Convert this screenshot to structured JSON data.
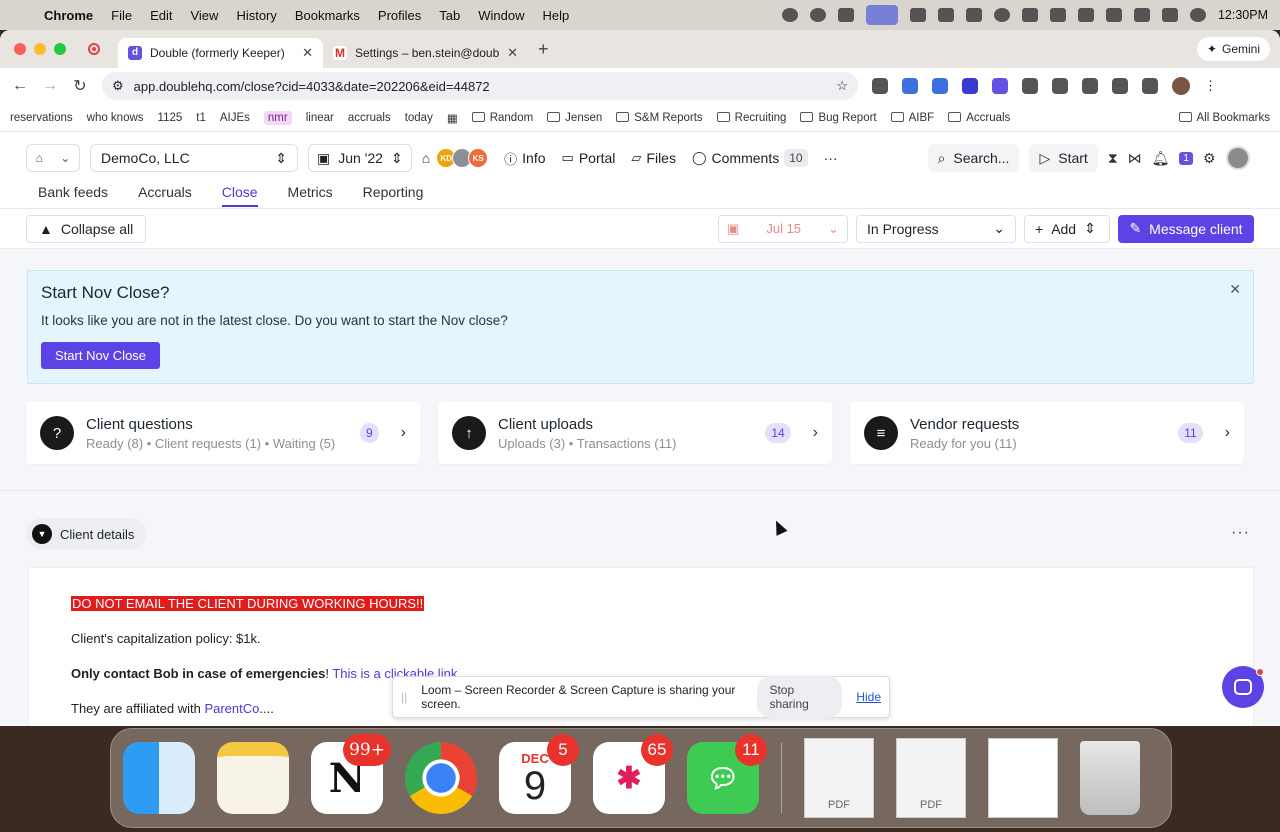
{
  "menubar": {
    "apple": "",
    "items": [
      "Chrome",
      "File",
      "Edit",
      "View",
      "History",
      "Bookmarks",
      "Profiles",
      "Tab",
      "Window",
      "Help"
    ],
    "clock": "12:30PM"
  },
  "browser": {
    "tabs": [
      {
        "title": "Double (formerly Keeper)",
        "favicon": "d"
      },
      {
        "title": "Settings – ben.stein@doublehq",
        "favicon": "M"
      }
    ],
    "gemini": "Gemini",
    "url": "app.doublehq.com/close?cid=4033&date=202206&eid=44872",
    "bookmarks": [
      "reservations",
      "who knows",
      "1125",
      "t1",
      "AIJEs",
      "nmr",
      "linear",
      "accruals",
      "today"
    ],
    "bookmark_folders": [
      "Random",
      "Jensen",
      "S&M Reports",
      "Recruiting",
      "Bug Report",
      "AIBF",
      "Accruals"
    ],
    "all_bookmarks": "All Bookmarks"
  },
  "app": {
    "company": "DemoCo, LLC",
    "period": "Jun '22",
    "avatars": [
      {
        "initials": "KD",
        "color": "#f0a30a"
      },
      {
        "initials": "",
        "color": "#8a8f98"
      },
      {
        "initials": "KS",
        "color": "#ef6b3a"
      }
    ],
    "links": {
      "info": "Info",
      "portal": "Portal",
      "files": "Files",
      "comments": "Comments",
      "comments_count": "10"
    },
    "search": "Search...",
    "start": "Start",
    "notifications": "1",
    "tabs": [
      "Bank feeds",
      "Accruals",
      "Close",
      "Metrics",
      "Reporting"
    ],
    "active_tab": "Close",
    "toolbar": {
      "collapse_all": "Collapse all",
      "date": "Jul 15",
      "status": "In Progress",
      "add": "Add",
      "message_client": "Message client"
    },
    "banner": {
      "title": "Start Nov Close?",
      "body": "It looks like you are not in the latest close. Do you want to start the Nov close?",
      "button": "Start Nov Close"
    },
    "cards": [
      {
        "title": "Client questions",
        "subtitle": "Ready (8) • Client requests (1) • Waiting (5)",
        "count": "9",
        "icon": "question-icon"
      },
      {
        "title": "Client uploads",
        "subtitle": "Uploads (3) • Transactions (11)",
        "count": "14",
        "icon": "upload-icon"
      },
      {
        "title": "Vendor requests",
        "subtitle": "Ready for you (11)",
        "count": "11",
        "icon": "document-icon"
      }
    ],
    "details": {
      "header": "Client details",
      "warning": "DO NOT EMAIL THE CLIENT DURING WORKING HOURS!!",
      "policy": "Client's capitalization policy: $1k.",
      "contact_bold": "Only contact Bob in case of emergencies",
      "contact_punct": "!",
      "link": "This is a clickable link",
      "affiliated_prefix": "They are affiliated with ",
      "affiliated_link": "ParentCo",
      "affiliated_suffix": "...."
    }
  },
  "loom": {
    "message": "Loom – Screen Recorder & Screen Capture is sharing your screen.",
    "stop": "Stop sharing",
    "hide": "Hide"
  },
  "dock": {
    "notion_badge": "99+",
    "calendar_month": "DEC",
    "calendar_day": "9",
    "calendar_badge": "5",
    "slack_badge": "65",
    "messages_badge": "11",
    "file1": "PDF",
    "file2": "PDF"
  }
}
